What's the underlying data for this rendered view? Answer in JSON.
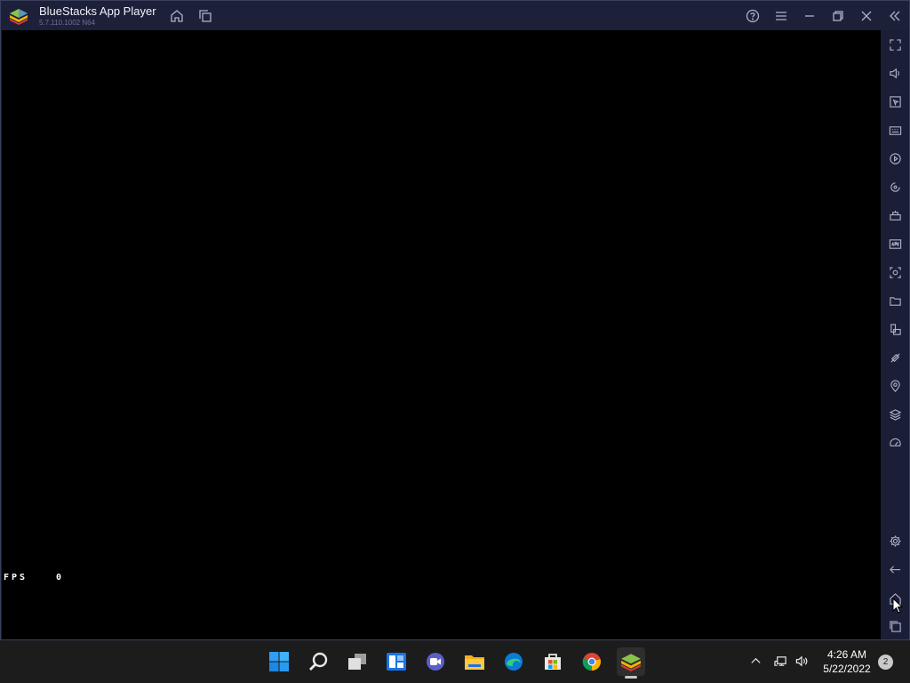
{
  "window": {
    "title": "BlueStacks App Player",
    "version": "5.7.110.1002 N64"
  },
  "titlebar_icons": [
    "home-icon",
    "multi-instance-icon",
    "help-icon",
    "menu-icon",
    "minimize-icon",
    "restore-icon",
    "close-icon",
    "collapse-sidebar-icon"
  ],
  "screen": {
    "fps_label": "FPS",
    "fps_value": "0"
  },
  "sidebar_icons": [
    "fullscreen-icon",
    "volume-icon",
    "pointer-icon",
    "keyboard-icon",
    "macro-record-icon",
    "rotate-icon",
    "game-controls-icon",
    "apk-install-icon",
    "screenshot-icon",
    "folder-icon",
    "multi-instance-icon",
    "eco-mode-icon",
    "location-icon",
    "layers-icon",
    "speed-icon",
    "settings-icon",
    "back-icon",
    "home-icon",
    "recent-apps-icon"
  ],
  "taskbar": {
    "apps": [
      "windows-start-icon",
      "search-icon",
      "task-view-icon",
      "widgets-icon",
      "teams-chat-icon",
      "file-explorer-icon",
      "edge-icon",
      "store-icon",
      "chrome-icon",
      "bluestacks-icon"
    ],
    "time": "4:26 AM",
    "date": "5/22/2022",
    "notification_count": "2"
  }
}
